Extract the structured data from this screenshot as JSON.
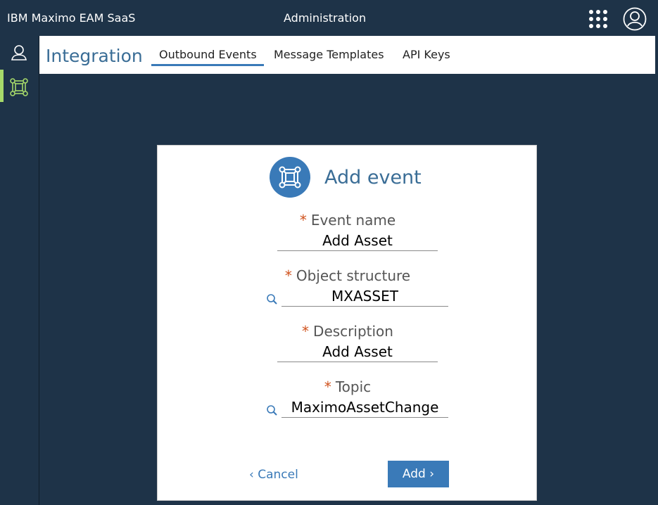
{
  "header": {
    "brand": "IBM Maximo EAM SaaS",
    "section": "Administration"
  },
  "subheader": {
    "title": "Integration",
    "tabs": [
      {
        "label": "Outbound Events",
        "active": true
      },
      {
        "label": "Message Templates",
        "active": false
      },
      {
        "label": "API Keys",
        "active": false
      }
    ]
  },
  "dialog": {
    "title": "Add event",
    "required_marker": "*",
    "fields": [
      {
        "label": "Event name",
        "value": "Add Asset",
        "lookup": false
      },
      {
        "label": "Object structure",
        "value": "MXASSET",
        "lookup": true
      },
      {
        "label": "Description",
        "value": "Add Asset",
        "lookup": false
      },
      {
        "label": "Topic",
        "value": "MaximoAssetChange",
        "lookup": true
      }
    ],
    "cancel_label": "Cancel",
    "add_label": "Add"
  },
  "colors": {
    "header_bg": "#1e3348",
    "accent": "#3a7ab8",
    "title_text": "#3a6d96",
    "required": "#d0521d",
    "active_rail": "#a6d96a"
  },
  "icons": {
    "apps": "grid-dots-icon",
    "user": "user-avatar-icon",
    "profile": "person-icon",
    "integration": "network-icon",
    "lookup": "magnifier-icon",
    "cancel": "chevron-left-icon",
    "add": "chevron-right-icon"
  }
}
